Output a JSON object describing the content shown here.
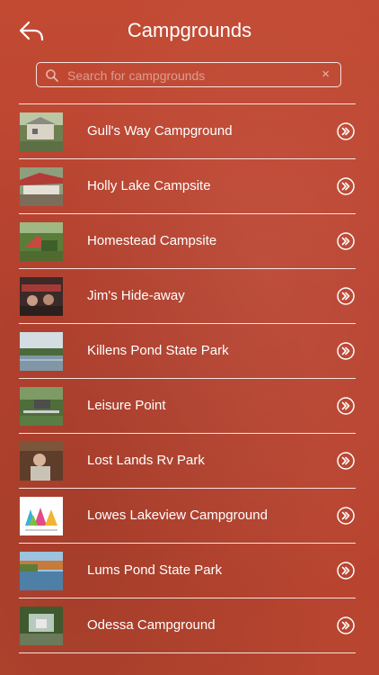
{
  "header": {
    "title": "Campgrounds",
    "back_icon": "back-arrow-icon"
  },
  "search": {
    "placeholder": "Search for campgrounds",
    "value": "",
    "clear_label": "×"
  },
  "campgrounds": [
    {
      "name": "Gull's Way Campground"
    },
    {
      "name": "Holly Lake Campsite"
    },
    {
      "name": "Homestead Campsite"
    },
    {
      "name": "Jim's Hide-away"
    },
    {
      "name": "Killens Pond State Park"
    },
    {
      "name": "Leisure Point"
    },
    {
      "name": "Lost Lands Rv Park"
    },
    {
      "name": "Lowes Lakeview Campground"
    },
    {
      "name": "Lums Pond State Park"
    },
    {
      "name": "Odessa Campground"
    }
  ],
  "colors": {
    "background": "#bd4732",
    "text": "#ffffff"
  }
}
